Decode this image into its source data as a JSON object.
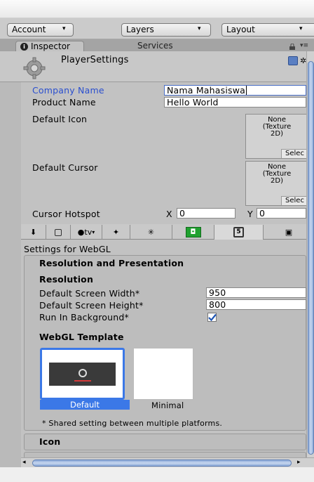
{
  "toolbar": {
    "account_label": "Account",
    "layers_label": "Layers",
    "layout_label": "Layout",
    "dropdown_arrow": "▾"
  },
  "tabs": {
    "inspector_label": "Inspector",
    "services_label": "Services"
  },
  "header": {
    "title": "PlayerSettings"
  },
  "fields": {
    "company_name_label": "Company Name",
    "company_name_value": "Nama Mahasiswa",
    "product_name_label": "Product Name",
    "product_name_value": "Hello World",
    "default_icon_label": "Default Icon",
    "default_cursor_label": "Default Cursor",
    "object_none_text": "None\n(Texture\n2D)",
    "select_label": "Selec",
    "cursor_hotspot_label": "Cursor Hotspot",
    "hotspot_x_label": "X",
    "hotspot_x_value": "0",
    "hotspot_y_label": "Y",
    "hotspot_y_value": "0"
  },
  "platform_tabs": {
    "appletv_label": "tv"
  },
  "webgl": {
    "settings_for": "Settings for WebGL",
    "resolution_presentation": "Resolution and Presentation",
    "resolution": "Resolution",
    "default_width_label": "Default Screen Width*",
    "default_width_value": "950",
    "default_height_label": "Default Screen Height*",
    "default_height_value": "800",
    "run_in_background_label": "Run In Background*",
    "run_in_background_checked": true,
    "template_heading": "WebGL Template",
    "template_default_label": "Default",
    "template_minimal_label": "Minimal",
    "shared_note": "* Shared setting between multiple platforms."
  },
  "sections": {
    "icon_label": "Icon"
  },
  "colors": {
    "selection_blue": "#3b78e7",
    "label_highlight": "#2a4fcf",
    "scroll_thumb": "#8ba9d8"
  }
}
